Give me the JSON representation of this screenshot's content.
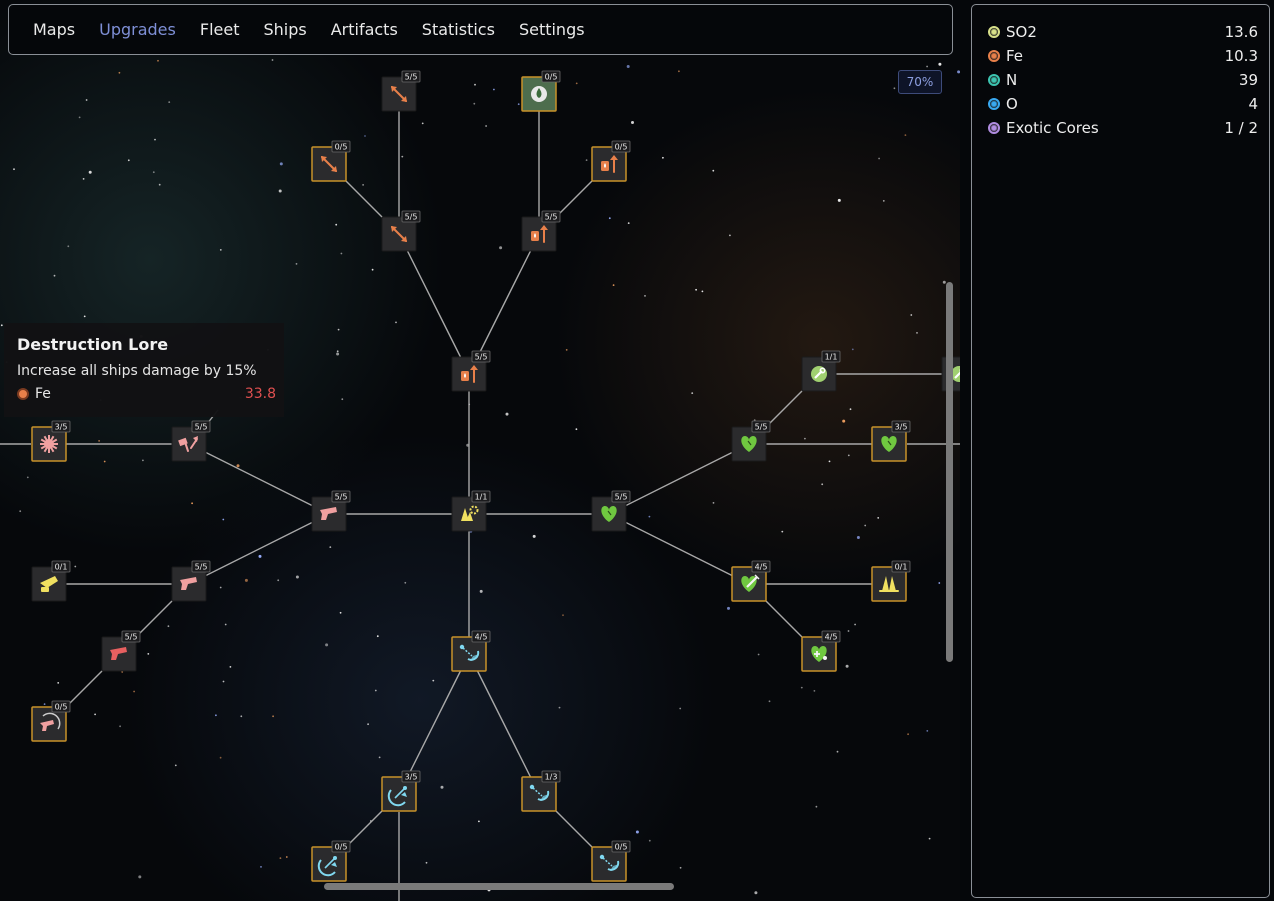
{
  "nav": {
    "items": [
      {
        "label": "Maps",
        "active": false
      },
      {
        "label": "Upgrades",
        "active": true
      },
      {
        "label": "Fleet",
        "active": false
      },
      {
        "label": "Ships",
        "active": false
      },
      {
        "label": "Artifacts",
        "active": false
      },
      {
        "label": "Statistics",
        "active": false
      },
      {
        "label": "Settings",
        "active": false
      }
    ]
  },
  "zoom": "70%",
  "tooltip": {
    "title": "Destruction Lore",
    "description": "Increase all ships damage by 15%",
    "cost_resource": "Fe",
    "cost_value": "33.8",
    "cost_color": "#e05050"
  },
  "resources": [
    {
      "name": "SO2",
      "amount": "13.6",
      "color": "#d8e08a"
    },
    {
      "name": "Fe",
      "amount": "10.3",
      "color": "#e8804a"
    },
    {
      "name": "N",
      "amount": "39",
      "color": "#3cc4b0"
    },
    {
      "name": "O",
      "amount": "4",
      "color": "#38a8f0"
    },
    {
      "name": "Exotic Cores",
      "amount": "1 / 2",
      "color": "#b08ce0"
    }
  ],
  "upgrade_nodes": [
    {
      "id": "core",
      "level": "1/1",
      "icon": "fleet-gear-icon",
      "color": "#f0e060",
      "state": "maxed"
    },
    {
      "id": "fire-main",
      "level": "5/5",
      "icon": "fuel-up-icon",
      "color": "#e8804a",
      "state": "maxed"
    },
    {
      "id": "fire-right",
      "level": "5/5",
      "icon": "fuel-up-icon",
      "color": "#e8804a",
      "state": "maxed"
    },
    {
      "id": "fire-top-right",
      "level": "0/5",
      "icon": "fuel-up-icon",
      "color": "#e8804a",
      "state": "available"
    },
    {
      "id": "drop-top",
      "level": "0/5",
      "icon": "droplet-icon",
      "color": "#e8e8e8",
      "state": "available"
    },
    {
      "id": "arrows-mid",
      "level": "5/5",
      "icon": "expand-arrows-icon",
      "color": "#e8804a",
      "state": "maxed"
    },
    {
      "id": "arrows-top",
      "level": "5/5",
      "icon": "expand-arrows-icon",
      "color": "#e8804a",
      "state": "maxed"
    },
    {
      "id": "arrows-left",
      "level": "0/5",
      "icon": "expand-arrows-icon",
      "color": "#e8804a",
      "state": "available"
    },
    {
      "id": "gun-main",
      "level": "5/5",
      "icon": "gun-icon",
      "color": "#f0a0a0",
      "state": "maxed"
    },
    {
      "id": "hammer",
      "level": "5/5",
      "icon": "hammer-up-icon",
      "color": "#f0a0a0",
      "state": "maxed"
    },
    {
      "id": "burst",
      "level": "3/5",
      "icon": "burst-icon",
      "color": "#f0a0a0",
      "state": "available"
    },
    {
      "id": "gun-lower",
      "level": "5/5",
      "icon": "gun-icon",
      "color": "#f0a0a0",
      "state": "maxed"
    },
    {
      "id": "cannon",
      "level": "0/1",
      "icon": "cannon-icon",
      "color": "#f0e060",
      "state": "maxed"
    },
    {
      "id": "gun-low2",
      "level": "5/5",
      "icon": "gun-icon",
      "color": "#e86060",
      "state": "maxed"
    },
    {
      "id": "gun-bottom",
      "level": "0/5",
      "icon": "gun-target-icon",
      "color": "#f0a0a0",
      "state": "available"
    },
    {
      "id": "heart-main",
      "level": "5/5",
      "icon": "heart-icon",
      "color": "#70c840",
      "state": "maxed"
    },
    {
      "id": "heart-up",
      "level": "5/5",
      "icon": "heart-icon",
      "color": "#70c840",
      "state": "maxed"
    },
    {
      "id": "wrench",
      "level": "1/1",
      "icon": "wrench-icon",
      "color": "#a0d070",
      "state": "maxed"
    },
    {
      "id": "edge-top",
      "level": "",
      "icon": "wrench-icon",
      "color": "#a0d070",
      "state": "maxed"
    },
    {
      "id": "heart-right",
      "level": "3/5",
      "icon": "heart-icon",
      "color": "#70c840",
      "state": "available"
    },
    {
      "id": "heart-syringe",
      "level": "4/5",
      "icon": "heart-syringe-icon",
      "color": "#70c840",
      "state": "available"
    },
    {
      "id": "fleet-right",
      "level": "0/1",
      "icon": "fleet-icon",
      "color": "#f0e060",
      "state": "available"
    },
    {
      "id": "heart-plus",
      "level": "4/5",
      "icon": "heart-plus-icon",
      "color": "#70c840",
      "state": "available"
    },
    {
      "id": "bolt-main",
      "level": "4/5",
      "icon": "bolt-dish-icon",
      "color": "#80d8f0",
      "state": "available"
    },
    {
      "id": "dish-left",
      "level": "3/5",
      "icon": "dish-icon",
      "color": "#80d8f0",
      "state": "available"
    },
    {
      "id": "dish-left2",
      "level": "0/5",
      "icon": "dish-icon",
      "color": "#80d8f0",
      "state": "available"
    },
    {
      "id": "bolt-right",
      "level": "1/3",
      "icon": "bolt-dish-icon",
      "color": "#80d8f0",
      "state": "available"
    },
    {
      "id": "bolt-right2",
      "level": "0/5",
      "icon": "bolt-dish-icon",
      "color": "#80d8f0",
      "state": "available"
    }
  ]
}
